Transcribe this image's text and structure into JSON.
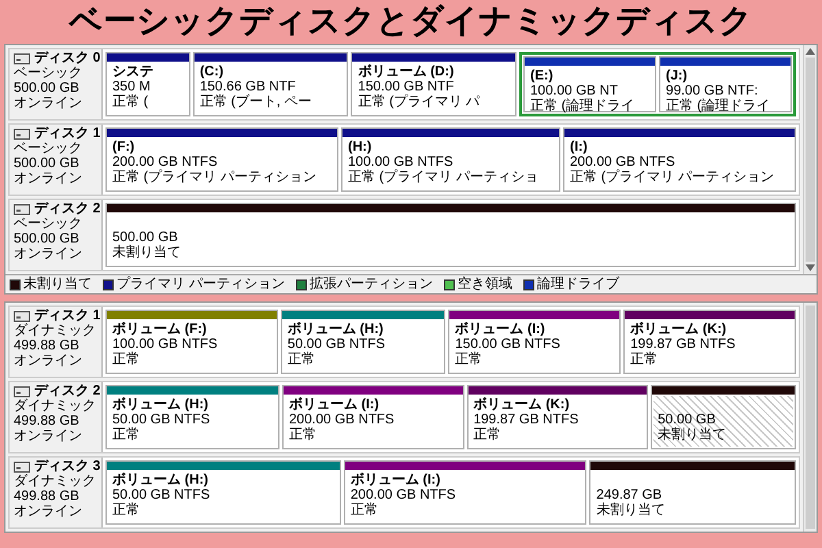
{
  "title": "ベーシックディスクとダイナミックディスク",
  "panels": [
    {
      "disks": [
        {
          "name": "ディスク 0",
          "type": "ベーシック",
          "size": "500.00 GB",
          "status": "オンライン",
          "partitions": [
            {
              "kind": "partition",
              "color": "#10108a",
              "name": "システ",
              "lines": [
                "350 M",
                "正常 ("
              ]
            },
            {
              "kind": "partition",
              "color": "#10108a",
              "name": "(C:)",
              "lines": [
                "150.66 GB NTF",
                "正常 (ブート, ペー"
              ]
            },
            {
              "kind": "partition",
              "color": "#10108a",
              "name": "ボリューム (D:)",
              "lines": [
                "150.00 GB NTF",
                "正常 (プライマリ パ"
              ]
            },
            {
              "kind": "extended",
              "children": [
                {
                  "kind": "partition",
                  "color": "#1030b0",
                  "name": "(E:)",
                  "lines": [
                    "100.00 GB NT",
                    "正常 (論理ドライ"
                  ]
                },
                {
                  "kind": "partition",
                  "color": "#1030b0",
                  "name": "(J:)",
                  "lines": [
                    "99.00 GB NTF:",
                    "正常 (論理ドライ"
                  ]
                }
              ]
            }
          ]
        },
        {
          "name": "ディスク 1",
          "type": "ベーシック",
          "size": "500.00 GB",
          "status": "オンライン",
          "partitions": [
            {
              "kind": "partition",
              "color": "#10108a",
              "name": "(F:)",
              "lines": [
                "200.00 GB NTFS",
                "正常 (プライマリ パーティション"
              ]
            },
            {
              "kind": "partition",
              "color": "#10108a",
              "name": "(H:)",
              "lines": [
                "100.00 GB NTFS",
                "正常 (プライマリ パーティショ"
              ]
            },
            {
              "kind": "partition",
              "color": "#10108a",
              "name": "(I:)",
              "lines": [
                "200.00 GB NTFS",
                "正常 (プライマリ パーティション"
              ]
            }
          ]
        },
        {
          "name": "ディスク 2",
          "type": "ベーシック",
          "size": "500.00 GB",
          "status": "オンライン",
          "partitions": [
            {
              "kind": "partition",
              "color": "#200808",
              "lines": [
                "500.00 GB",
                "未割り当て"
              ]
            }
          ]
        }
      ],
      "legend": [
        {
          "label": "未割り当て",
          "color": "#200808"
        },
        {
          "label": "プライマリ パーティション",
          "color": "#10108a"
        },
        {
          "label": "拡張パーティション",
          "color": "#208040"
        },
        {
          "label": "空き領域",
          "color": "#50c050"
        },
        {
          "label": "論理ドライブ",
          "color": "#1030b0"
        }
      ]
    },
    {
      "disks": [
        {
          "name": "ディスク 1",
          "type": "ダイナミック",
          "size": "499.88 GB",
          "status": "オンライン",
          "partitions": [
            {
              "kind": "partition",
              "color": "#808000",
              "name": "ボリューム (F:)",
              "lines": [
                "100.00 GB NTFS",
                "正常"
              ]
            },
            {
              "kind": "partition",
              "color": "#008080",
              "name": "ボリューム (H:)",
              "lines": [
                "50.00 GB NTFS",
                "正常"
              ]
            },
            {
              "kind": "partition",
              "color": "#800080",
              "name": "ボリューム (I:)",
              "lines": [
                "150.00 GB NTFS",
                "正常"
              ]
            },
            {
              "kind": "partition",
              "color": "#600060",
              "name": "ボリューム (K:)",
              "lines": [
                "199.87 GB NTFS",
                "正常"
              ]
            }
          ]
        },
        {
          "name": "ディスク 2",
          "type": "ダイナミック",
          "size": "499.88 GB",
          "status": "オンライン",
          "partitions": [
            {
              "kind": "partition",
              "color": "#008080",
              "name": "ボリューム (H:)",
              "lines": [
                "50.00 GB NTFS",
                "正常"
              ]
            },
            {
              "kind": "partition",
              "color": "#800080",
              "name": "ボリューム (I:)",
              "lines": [
                "200.00 GB NTFS",
                "正常"
              ]
            },
            {
              "kind": "partition",
              "color": "#600060",
              "name": "ボリューム (K:)",
              "lines": [
                "199.87 GB NTFS",
                "正常"
              ]
            },
            {
              "kind": "partition",
              "color": "#200808",
              "hatched": true,
              "lines": [
                "50.00 GB",
                "未割り当て"
              ]
            }
          ]
        },
        {
          "name": "ディスク 3",
          "type": "ダイナミック",
          "size": "499.88 GB",
          "status": "オンライン",
          "partitions": [
            {
              "kind": "partition",
              "color": "#008080",
              "name": "ボリューム (H:)",
              "lines": [
                "50.00 GB NTFS",
                "正常"
              ]
            },
            {
              "kind": "partition",
              "color": "#800080",
              "name": "ボリューム (I:)",
              "lines": [
                "200.00 GB NTFS",
                "正常"
              ]
            },
            {
              "kind": "partition",
              "color": "#200808",
              "lines": [
                "249.87 GB",
                "未割り当て"
              ]
            }
          ]
        }
      ]
    }
  ]
}
